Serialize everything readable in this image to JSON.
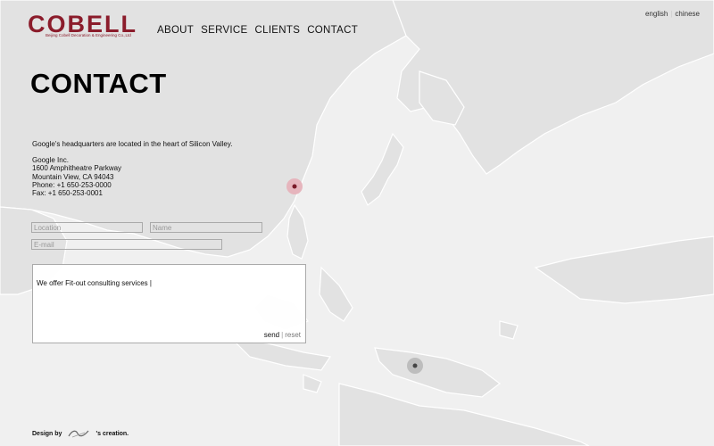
{
  "brand": {
    "logo_text": "COBELL",
    "logo_subtitle": "Beijing Cobell Decoration & Engineering Co.,Ltd",
    "color": "#8b1c2b"
  },
  "nav": [
    "ABOUT",
    "SERVICE",
    "CLIENTS",
    "CONTACT"
  ],
  "lang": [
    "english",
    "chinese"
  ],
  "page_title": "CONTACT",
  "info": {
    "intro": "Google's headquarters are located in the heart of Silicon Valley.",
    "lines": [
      "Google Inc.",
      "1600 Amphitheatre Parkway",
      "Mountain View, CA 94043",
      "Phone: +1 650-253-0000",
      "Fax: +1 650-253-0001"
    ]
  },
  "form": {
    "location_placeholder": "Location",
    "name_placeholder": "Name",
    "email_placeholder": "E-mail",
    "message": "We offer Fit-out consulting services  |",
    "send": "send",
    "reset": "reset"
  },
  "footer": {
    "prefix": "Design by",
    "suffix": "'s creation."
  }
}
